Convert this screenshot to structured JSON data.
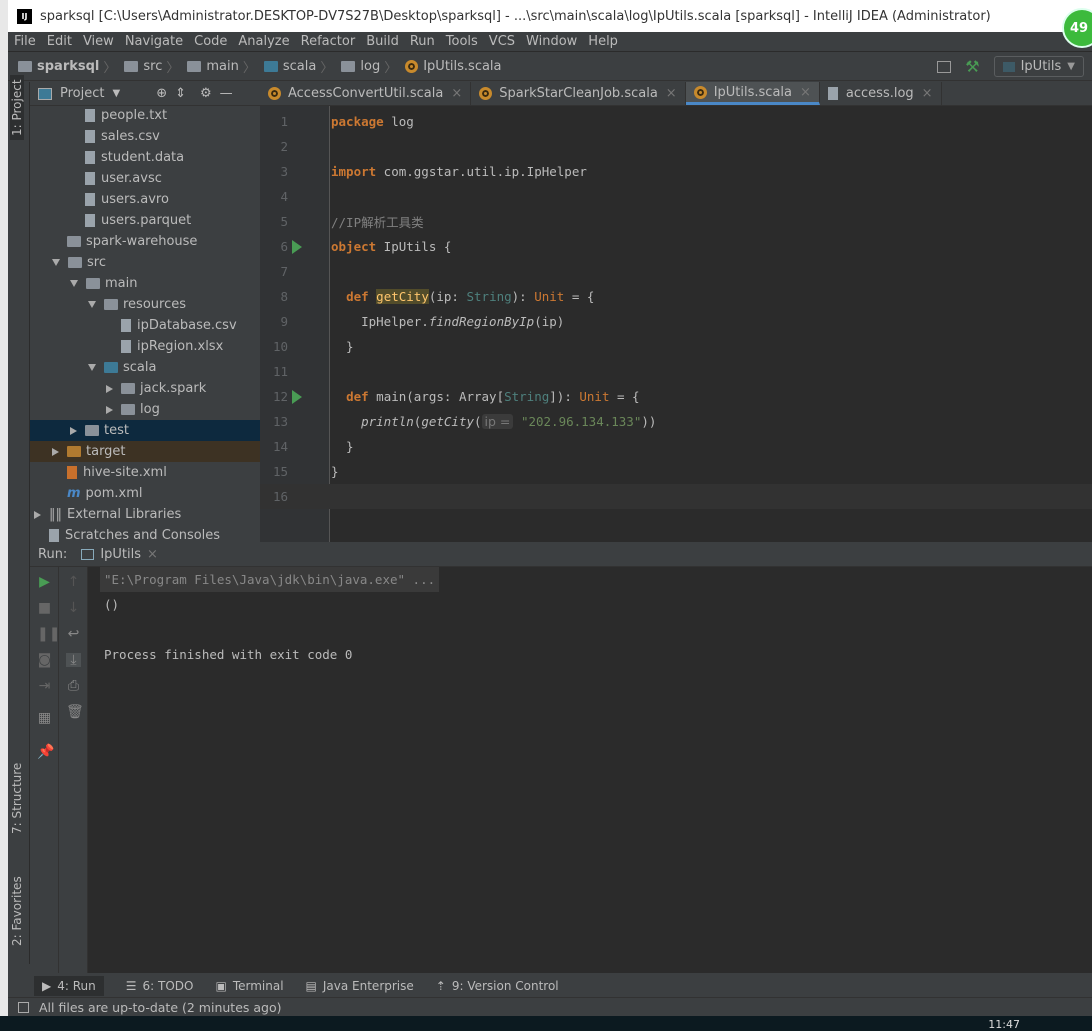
{
  "window": {
    "title": "sparksql [C:\\Users\\Administrator.DESKTOP-DV7S27B\\Desktop\\sparksql] - ...\\src\\main\\scala\\log\\IpUtils.scala [sparksql] - IntelliJ IDEA (Administrator)",
    "badge": "49"
  },
  "menu": [
    "File",
    "Edit",
    "View",
    "Navigate",
    "Code",
    "Analyze",
    "Refactor",
    "Build",
    "Run",
    "Tools",
    "VCS",
    "Window",
    "Help"
  ],
  "breadcrumb": [
    "sparksql",
    "src",
    "main",
    "scala",
    "log",
    "IpUtils.scala"
  ],
  "run_config": "IpUtils",
  "side_tabs": {
    "project": "1: Project",
    "structure": "7: Structure",
    "favorites": "2: Favorites"
  },
  "project": {
    "title": "Project",
    "tree": [
      {
        "label": "people.txt",
        "level": 3,
        "type": "file"
      },
      {
        "label": "sales.csv",
        "level": 3,
        "type": "file"
      },
      {
        "label": "student.data",
        "level": 3,
        "type": "file"
      },
      {
        "label": "user.avsc",
        "level": 3,
        "type": "file"
      },
      {
        "label": "users.avro",
        "level": 3,
        "type": "file"
      },
      {
        "label": "users.parquet",
        "level": 3,
        "type": "file"
      },
      {
        "label": "spark-warehouse",
        "level": 2,
        "type": "folder"
      },
      {
        "label": "src",
        "level": 2,
        "type": "folder",
        "state": "open"
      },
      {
        "label": "main",
        "level": 3,
        "type": "folder",
        "state": "open"
      },
      {
        "label": "resources",
        "level": 4,
        "type": "folder",
        "state": "open"
      },
      {
        "label": "ipDatabase.csv",
        "level": 5,
        "type": "file"
      },
      {
        "label": "ipRegion.xlsx",
        "level": 5,
        "type": "file"
      },
      {
        "label": "scala",
        "level": 4,
        "type": "folder-blue",
        "state": "open"
      },
      {
        "label": "jack.spark",
        "level": 5,
        "type": "package",
        "state": "closed"
      },
      {
        "label": "log",
        "level": 5,
        "type": "package",
        "state": "closed"
      },
      {
        "label": "test",
        "level": 3,
        "type": "folder",
        "state": "closed",
        "selected": true
      },
      {
        "label": "target",
        "level": 2,
        "type": "folder-orange",
        "state": "closed",
        "highlight": true
      },
      {
        "label": "hive-site.xml",
        "level": 2,
        "type": "xml"
      },
      {
        "label": "pom.xml",
        "level": 2,
        "type": "maven"
      },
      {
        "label": "External Libraries",
        "level": 1,
        "type": "lib",
        "state": "closed"
      },
      {
        "label": "Scratches and Consoles",
        "level": 1,
        "type": "scratch"
      }
    ]
  },
  "tabs": [
    {
      "label": "AccessConvertUtil.scala"
    },
    {
      "label": "SparkStarCleanJob.scala"
    },
    {
      "label": "IpUtils.scala",
      "active": true
    },
    {
      "label": "access.log"
    }
  ],
  "code": [
    {
      "n": "1",
      "t": [
        [
          "package",
          "kw"
        ],
        [
          " log",
          ""
        ]
      ]
    },
    {
      "n": "2",
      "t": []
    },
    {
      "n": "3",
      "t": [
        [
          "import",
          "kw"
        ],
        [
          " com.ggstar.util.ip.IpHelper",
          ""
        ]
      ]
    },
    {
      "n": "4",
      "t": []
    },
    {
      "n": "5",
      "t": [
        [
          "//IP解析工具类",
          "cm"
        ]
      ]
    },
    {
      "n": "6",
      "t": [
        [
          "object",
          "kw"
        ],
        [
          " IpUtils {",
          ""
        ]
      ],
      "run": true
    },
    {
      "n": "7",
      "t": []
    },
    {
      "n": "8",
      "t": [
        [
          "  ",
          ""
        ],
        [
          "def",
          "kw"
        ],
        [
          " ",
          ""
        ],
        [
          "getCity",
          "hlt"
        ],
        [
          "(ip: ",
          ""
        ],
        [
          "String",
          "tp"
        ],
        [
          "): ",
          ""
        ],
        [
          "Unit",
          "un"
        ],
        [
          " = {",
          ""
        ]
      ]
    },
    {
      "n": "9",
      "t": [
        [
          "    IpHelper.",
          ""
        ],
        [
          "findRegionByIp",
          "it"
        ],
        [
          "(ip)",
          ""
        ]
      ]
    },
    {
      "n": "10",
      "t": [
        [
          "  }",
          ""
        ]
      ]
    },
    {
      "n": "11",
      "t": []
    },
    {
      "n": "12",
      "t": [
        [
          "  ",
          ""
        ],
        [
          "def",
          "kw"
        ],
        [
          " main(args: Array[",
          ""
        ],
        [
          "String",
          "tp"
        ],
        [
          "]): ",
          ""
        ],
        [
          "Unit",
          "un"
        ],
        [
          " = {",
          ""
        ]
      ],
      "run": true
    },
    {
      "n": "13",
      "t": [
        [
          "    ",
          ""
        ],
        [
          "println",
          "it"
        ],
        [
          "(",
          ""
        ],
        [
          "getCity",
          "it"
        ],
        [
          "(",
          ""
        ],
        [
          "ip =",
          "hint"
        ],
        [
          " ",
          ""
        ],
        [
          "\"202.96.134.133\"",
          "st"
        ],
        [
          "))",
          ""
        ]
      ]
    },
    {
      "n": "14",
      "t": [
        [
          "  }",
          ""
        ]
      ]
    },
    {
      "n": "15",
      "t": [
        [
          "}",
          ""
        ]
      ]
    },
    {
      "n": "16",
      "t": [],
      "current": true
    }
  ],
  "run": {
    "label": "Run:",
    "tab": "IpUtils",
    "output": [
      "\"E:\\Program Files\\Java\\jdk\\bin\\java.exe\" ...",
      "()",
      "",
      "Process finished with exit code 0"
    ]
  },
  "bottom_tabs": [
    "4: Run",
    "6: TODO",
    "Terminal",
    "Java Enterprise",
    "9: Version Control"
  ],
  "status": "All files are up-to-date (2 minutes ago)",
  "clock": "11:47"
}
